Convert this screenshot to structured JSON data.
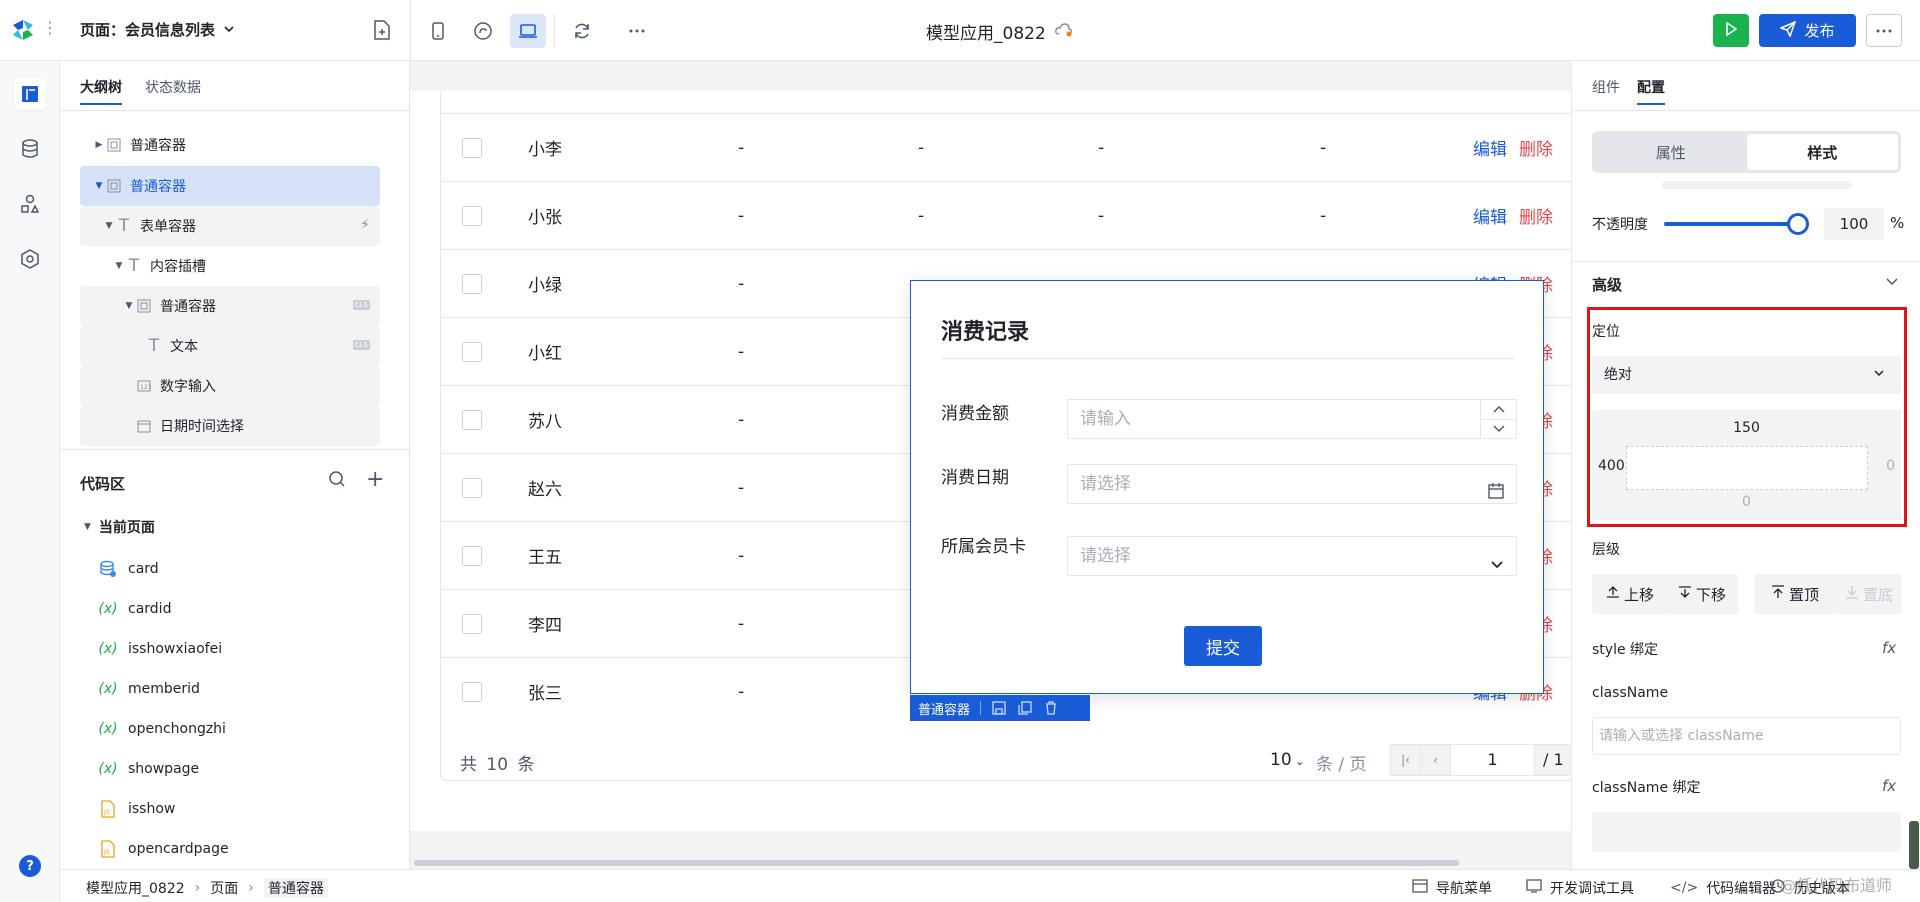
{
  "topbar": {
    "page_selector": "页面：会员信息列表",
    "app_title": "模型应用_0822",
    "publish_label": "发布"
  },
  "outline": {
    "tabs": [
      "大纲树",
      "状态数据"
    ],
    "tree": [
      {
        "label": "普通容器"
      },
      {
        "label": "普通容器"
      },
      {
        "label": "表单容器"
      },
      {
        "label": "内容插槽"
      },
      {
        "label": "普通容器",
        "badge": "CLS"
      },
      {
        "label": "文本",
        "badge": "CLS"
      },
      {
        "label": "数字输入"
      },
      {
        "label": "日期时间选择"
      }
    ]
  },
  "code": {
    "title": "代码区",
    "current_page": "当前页面",
    "items": [
      {
        "label": "card"
      },
      {
        "label": "cardid"
      },
      {
        "label": "isshowxiaofei"
      },
      {
        "label": "memberid"
      },
      {
        "label": "openchongzhi"
      },
      {
        "label": "showpage"
      },
      {
        "label": "isshow"
      },
      {
        "label": "opencardpage"
      }
    ],
    "var_icon": "(x)",
    "js_icon": "JS"
  },
  "table": {
    "rows": [
      {
        "name": "小李",
        "cells": [
          "-",
          "-",
          "-",
          "-"
        ]
      },
      {
        "name": "小张",
        "cells": [
          "-",
          "-",
          "-",
          "-"
        ]
      },
      {
        "name": "小绿",
        "cells": [
          "-",
          "-",
          "-",
          "-"
        ]
      },
      {
        "name": "小红",
        "cells": [
          "-",
          "-",
          "-",
          "-"
        ]
      },
      {
        "name": "苏八",
        "cells": [
          "-",
          "-",
          "-",
          "-"
        ]
      },
      {
        "name": "赵六",
        "cells": [
          "-",
          "-",
          "-",
          "-"
        ]
      },
      {
        "name": "王五",
        "cells": [
          "-",
          "-",
          "-",
          "-"
        ]
      },
      {
        "name": "李四",
        "cells": [
          "-",
          "-",
          "-",
          "-"
        ]
      },
      {
        "name": "张三",
        "cells": [
          "-",
          "-",
          "-",
          "-"
        ]
      }
    ],
    "edit_label": "编辑",
    "delete_label": "删除",
    "total": "共 10 条",
    "page_size": "10",
    "page_size_unit": "条 / 页",
    "page": "1",
    "page_total": "/ 1"
  },
  "dialog": {
    "title": "消费记录",
    "fields": [
      {
        "label": "消费金额",
        "placeholder": "请输入"
      },
      {
        "label": "消费日期",
        "placeholder": "请选择"
      },
      {
        "label": "所属会员卡",
        "placeholder": "请选择"
      }
    ],
    "submit_label": "提交",
    "selection_tag": "普通容器"
  },
  "config": {
    "tabs": [
      "组件",
      "配置"
    ],
    "segments": [
      "属性",
      "样式"
    ],
    "opacity_label": "不透明度",
    "opacity_value": "100",
    "opacity_unit": "%",
    "opacity_fraction": 1.0,
    "advanced_title": "高级",
    "position_label": "定位",
    "position_value": "绝对",
    "position_top": "150",
    "position_left": "400",
    "position_right": "0",
    "position_bottom": "0",
    "z_label": "层级",
    "z_buttons": [
      "上移",
      "下移",
      "置顶",
      "置底"
    ],
    "style_bind_label": "style 绑定",
    "fx": "fx",
    "classname_label": "className",
    "classname_placeholder": "请输入或选择 className",
    "classname_bind_label": "className 绑定"
  },
  "statusbar": {
    "breadcrumbs": [
      "模型应用_0822",
      "页面",
      "普通容器"
    ],
    "items": [
      "导航菜单",
      "开发调试工具",
      "代码编辑器",
      "历史版本"
    ]
  },
  "watermark": "@低代码布道师",
  "colors": {
    "primary": "#1a5cd7",
    "success": "#1bb34c",
    "danger": "#e5484d",
    "highlight_box": "#e0151b"
  }
}
